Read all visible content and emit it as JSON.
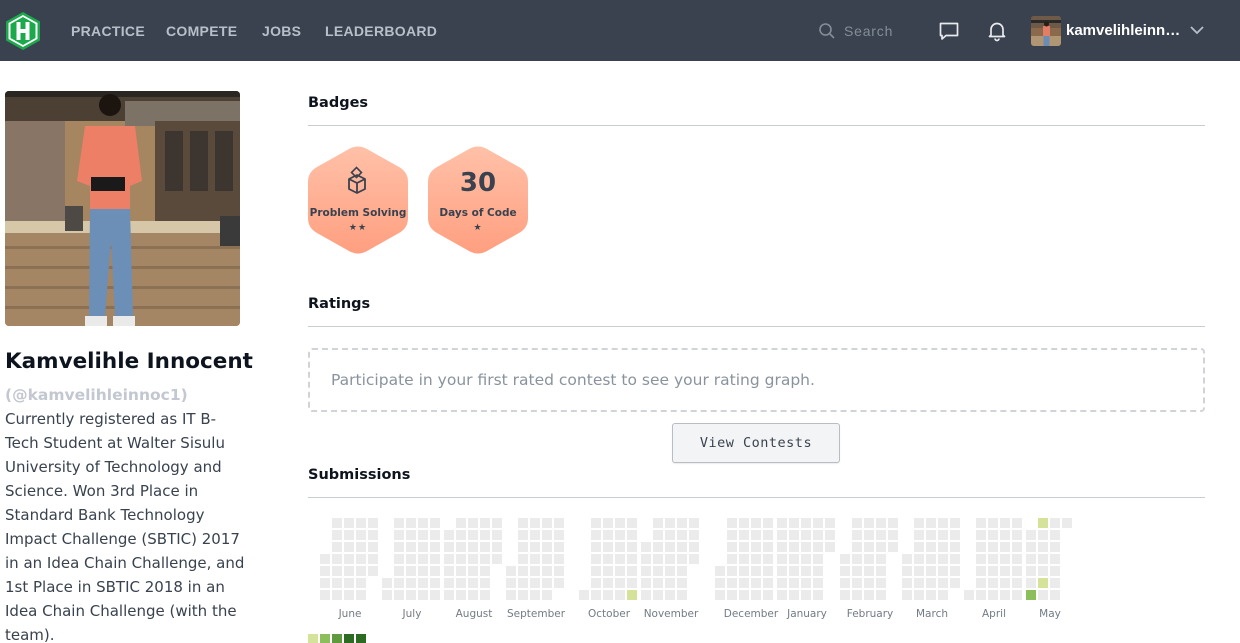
{
  "navbar": {
    "links": [
      "PRACTICE",
      "COMPETE",
      "JOBS",
      "LEADERBOARD"
    ],
    "search_placeholder": "Search",
    "username": "kamvelihleinn…",
    "colors": {
      "background": "#39424e",
      "logo": "#1ba94c",
      "link": "#b7c0ca"
    }
  },
  "profile": {
    "name": "Kamvelihle Innocent",
    "handle": "(@kamvelihleinnoc1)",
    "bio": "Currently registered as IT B-Tech Student at Walter Sisulu University of Technology and Science. Won 3rd Place in Standard Bank Technology Impact Challenge (SBTIC) 2017 in an Idea Chain Challenge, and 1st Place in SBTIC 2018 in an Idea Chain Challenge (with the team)."
  },
  "badges": {
    "title": "Badges",
    "items": [
      {
        "label": "Problem Solving",
        "stars": "★★",
        "icon": "problem-solving-icon"
      },
      {
        "number": "30",
        "label": "Days of Code",
        "stars": "★",
        "icon": "days-of-code"
      }
    ],
    "color": "#ffb295"
  },
  "ratings": {
    "title": "Ratings",
    "empty_message": "Participate in your first rated contest to see your rating graph.",
    "button_label": "View Contests"
  },
  "submissions": {
    "title": "Submissions",
    "months": [
      "June",
      "July",
      "August",
      "September",
      "October",
      "November",
      "December",
      "January",
      "February",
      "March",
      "April",
      "May"
    ],
    "active_days": [
      {
        "month": "October",
        "week": 4,
        "day": 6,
        "level": 1
      },
      {
        "month": "May",
        "week": 1,
        "day": 0,
        "level": 1
      },
      {
        "month": "May",
        "week": 1,
        "day": 5,
        "level": 1
      },
      {
        "month": "May",
        "week": 0,
        "day": 6,
        "level": 2
      }
    ],
    "colors": {
      "empty": "#ebebeb",
      "level1": "#d5e39a",
      "level2": "#8cbf5b",
      "level3": "#5f9b3c",
      "level4": "#2e6b22"
    }
  }
}
